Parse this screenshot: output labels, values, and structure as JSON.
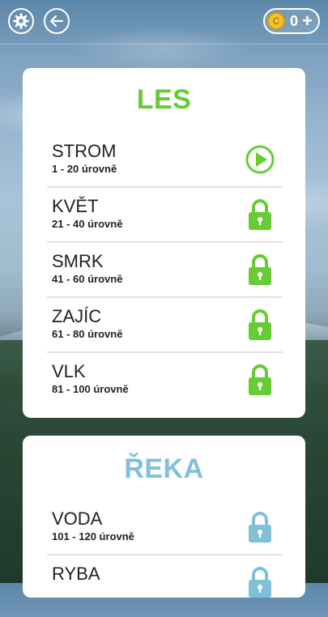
{
  "colors": {
    "les_title": "#66cc33",
    "reka_title": "#7fc1d8",
    "green": "#66cc33",
    "blue": "#7fc1d8"
  },
  "topbar": {
    "settings_icon": "gear-icon",
    "back_icon": "arrow-left-icon",
    "coin_symbol": "C",
    "coins": "0",
    "plus": "+"
  },
  "sections": [
    {
      "title": "LES",
      "levels": [
        {
          "name": "STROM",
          "range": "1 - 20 úrovně",
          "status": "play"
        },
        {
          "name": "KVĚT",
          "range": "21 - 40 úrovně",
          "status": "locked"
        },
        {
          "name": "SMRK",
          "range": "41 - 60 úrovně",
          "status": "locked"
        },
        {
          "name": "ZAJÍC",
          "range": "61 - 80 úrovně",
          "status": "locked"
        },
        {
          "name": "VLK",
          "range": "81 - 100 úrovně",
          "status": "locked"
        }
      ]
    },
    {
      "title": "ŘEKA",
      "levels": [
        {
          "name": "VODA",
          "range": "101 - 120 úrovně",
          "status": "locked"
        },
        {
          "name": "RYBA",
          "range": "",
          "status": "locked"
        }
      ]
    }
  ]
}
